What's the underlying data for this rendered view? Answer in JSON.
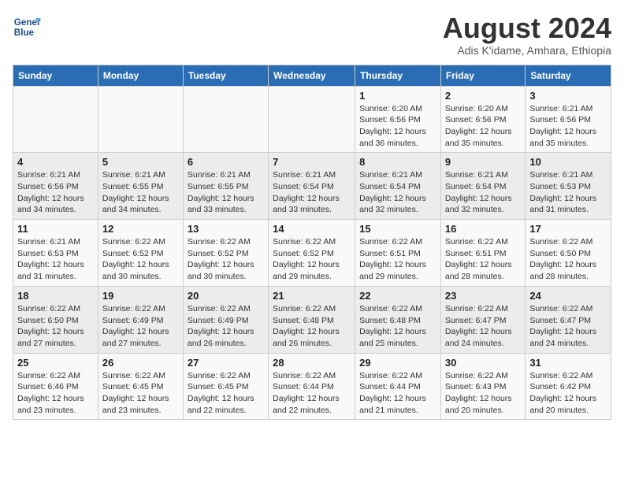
{
  "header": {
    "logo_line1": "General",
    "logo_line2": "Blue",
    "month_title": "August 2024",
    "subtitle": "Adis K'idame, Amhara, Ethiopia"
  },
  "days_of_week": [
    "Sunday",
    "Monday",
    "Tuesday",
    "Wednesday",
    "Thursday",
    "Friday",
    "Saturday"
  ],
  "weeks": [
    [
      {
        "day": "",
        "info": ""
      },
      {
        "day": "",
        "info": ""
      },
      {
        "day": "",
        "info": ""
      },
      {
        "day": "",
        "info": ""
      },
      {
        "day": "1",
        "info": "Sunrise: 6:20 AM\nSunset: 6:56 PM\nDaylight: 12 hours\nand 36 minutes."
      },
      {
        "day": "2",
        "info": "Sunrise: 6:20 AM\nSunset: 6:56 PM\nDaylight: 12 hours\nand 35 minutes."
      },
      {
        "day": "3",
        "info": "Sunrise: 6:21 AM\nSunset: 6:56 PM\nDaylight: 12 hours\nand 35 minutes."
      }
    ],
    [
      {
        "day": "4",
        "info": "Sunrise: 6:21 AM\nSunset: 6:56 PM\nDaylight: 12 hours\nand 34 minutes."
      },
      {
        "day": "5",
        "info": "Sunrise: 6:21 AM\nSunset: 6:55 PM\nDaylight: 12 hours\nand 34 minutes."
      },
      {
        "day": "6",
        "info": "Sunrise: 6:21 AM\nSunset: 6:55 PM\nDaylight: 12 hours\nand 33 minutes."
      },
      {
        "day": "7",
        "info": "Sunrise: 6:21 AM\nSunset: 6:54 PM\nDaylight: 12 hours\nand 33 minutes."
      },
      {
        "day": "8",
        "info": "Sunrise: 6:21 AM\nSunset: 6:54 PM\nDaylight: 12 hours\nand 32 minutes."
      },
      {
        "day": "9",
        "info": "Sunrise: 6:21 AM\nSunset: 6:54 PM\nDaylight: 12 hours\nand 32 minutes."
      },
      {
        "day": "10",
        "info": "Sunrise: 6:21 AM\nSunset: 6:53 PM\nDaylight: 12 hours\nand 31 minutes."
      }
    ],
    [
      {
        "day": "11",
        "info": "Sunrise: 6:21 AM\nSunset: 6:53 PM\nDaylight: 12 hours\nand 31 minutes."
      },
      {
        "day": "12",
        "info": "Sunrise: 6:22 AM\nSunset: 6:52 PM\nDaylight: 12 hours\nand 30 minutes."
      },
      {
        "day": "13",
        "info": "Sunrise: 6:22 AM\nSunset: 6:52 PM\nDaylight: 12 hours\nand 30 minutes."
      },
      {
        "day": "14",
        "info": "Sunrise: 6:22 AM\nSunset: 6:52 PM\nDaylight: 12 hours\nand 29 minutes."
      },
      {
        "day": "15",
        "info": "Sunrise: 6:22 AM\nSunset: 6:51 PM\nDaylight: 12 hours\nand 29 minutes."
      },
      {
        "day": "16",
        "info": "Sunrise: 6:22 AM\nSunset: 6:51 PM\nDaylight: 12 hours\nand 28 minutes."
      },
      {
        "day": "17",
        "info": "Sunrise: 6:22 AM\nSunset: 6:50 PM\nDaylight: 12 hours\nand 28 minutes."
      }
    ],
    [
      {
        "day": "18",
        "info": "Sunrise: 6:22 AM\nSunset: 6:50 PM\nDaylight: 12 hours\nand 27 minutes."
      },
      {
        "day": "19",
        "info": "Sunrise: 6:22 AM\nSunset: 6:49 PM\nDaylight: 12 hours\nand 27 minutes."
      },
      {
        "day": "20",
        "info": "Sunrise: 6:22 AM\nSunset: 6:49 PM\nDaylight: 12 hours\nand 26 minutes."
      },
      {
        "day": "21",
        "info": "Sunrise: 6:22 AM\nSunset: 6:48 PM\nDaylight: 12 hours\nand 26 minutes."
      },
      {
        "day": "22",
        "info": "Sunrise: 6:22 AM\nSunset: 6:48 PM\nDaylight: 12 hours\nand 25 minutes."
      },
      {
        "day": "23",
        "info": "Sunrise: 6:22 AM\nSunset: 6:47 PM\nDaylight: 12 hours\nand 24 minutes."
      },
      {
        "day": "24",
        "info": "Sunrise: 6:22 AM\nSunset: 6:47 PM\nDaylight: 12 hours\nand 24 minutes."
      }
    ],
    [
      {
        "day": "25",
        "info": "Sunrise: 6:22 AM\nSunset: 6:46 PM\nDaylight: 12 hours\nand 23 minutes."
      },
      {
        "day": "26",
        "info": "Sunrise: 6:22 AM\nSunset: 6:45 PM\nDaylight: 12 hours\nand 23 minutes."
      },
      {
        "day": "27",
        "info": "Sunrise: 6:22 AM\nSunset: 6:45 PM\nDaylight: 12 hours\nand 22 minutes."
      },
      {
        "day": "28",
        "info": "Sunrise: 6:22 AM\nSunset: 6:44 PM\nDaylight: 12 hours\nand 22 minutes."
      },
      {
        "day": "29",
        "info": "Sunrise: 6:22 AM\nSunset: 6:44 PM\nDaylight: 12 hours\nand 21 minutes."
      },
      {
        "day": "30",
        "info": "Sunrise: 6:22 AM\nSunset: 6:43 PM\nDaylight: 12 hours\nand 20 minutes."
      },
      {
        "day": "31",
        "info": "Sunrise: 6:22 AM\nSunset: 6:42 PM\nDaylight: 12 hours\nand 20 minutes."
      }
    ]
  ]
}
